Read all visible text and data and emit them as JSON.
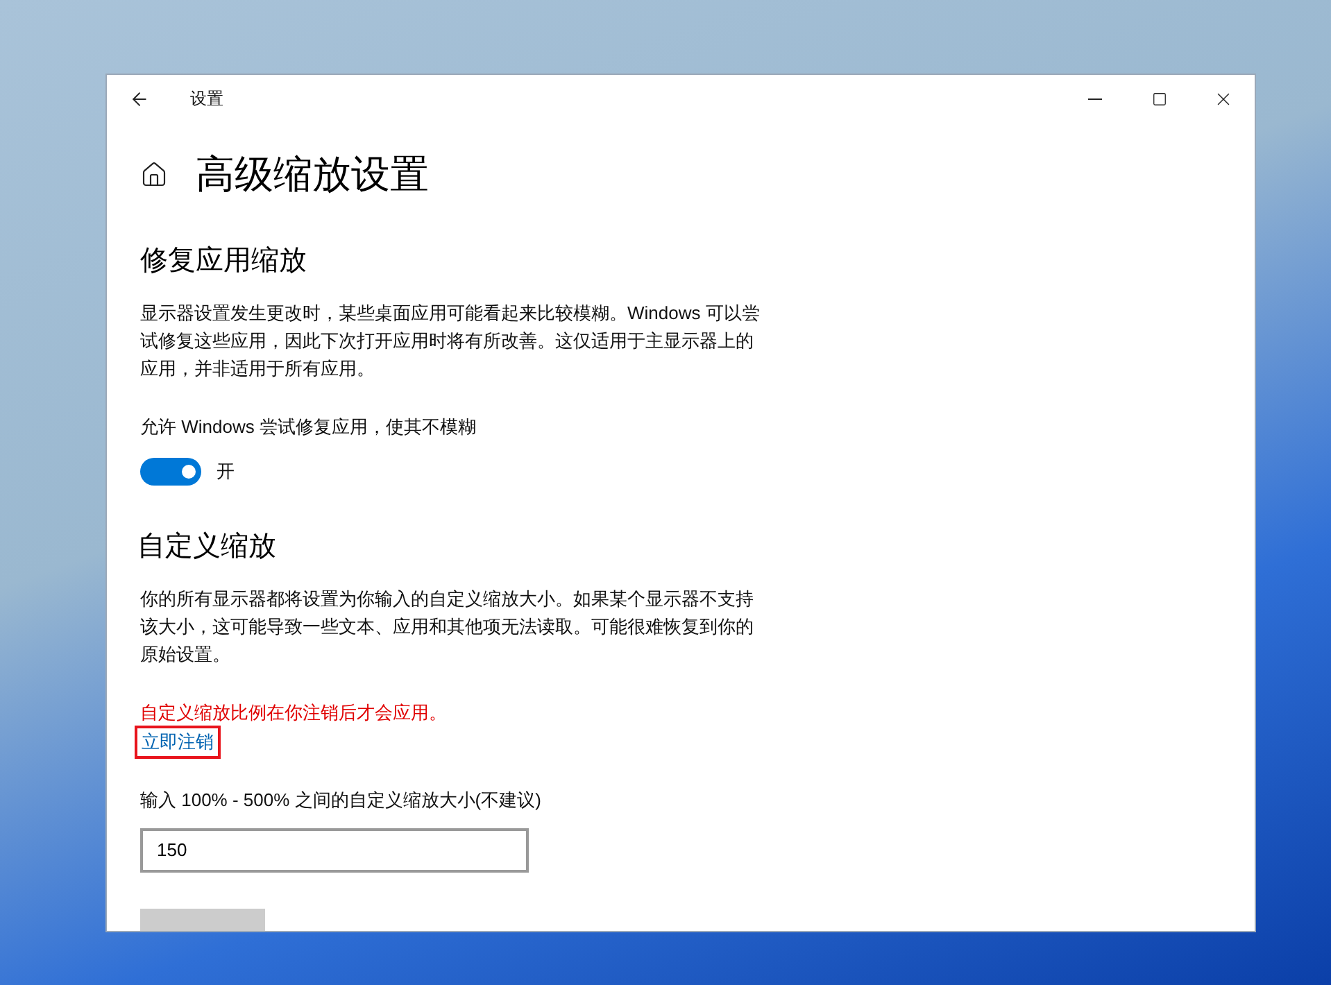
{
  "window": {
    "title": "设置"
  },
  "page": {
    "title": "高级缩放设置"
  },
  "fix_section": {
    "heading": "修复应用缩放",
    "description": "显示器设置发生更改时，某些桌面应用可能看起来比较模糊。Windows 可以尝试修复这些应用，因此下次打开应用时将有所改善。这仅适用于主显示器上的应用，并非适用于所有应用。",
    "toggle_label": "允许 Windows 尝试修复应用，使其不模糊",
    "toggle": {
      "on": true,
      "state_text": "开"
    }
  },
  "custom_section": {
    "heading": "自定义缩放",
    "description": "你的所有显示器都将设置为你输入的自定义缩放大小。如果某个显示器不支持该大小，这可能导致一些文本、应用和其他项无法读取。可能很难恢复到你的原始设置。",
    "warning": "自定义缩放比例在你注销后才会应用。",
    "link": {
      "label": "立即注销",
      "highlighted": true
    },
    "field_label": "输入 100% - 500% 之间的自定义缩放大小(不建议)",
    "field": {
      "value": "150"
    },
    "apply_button": {
      "disabled": true
    }
  }
}
